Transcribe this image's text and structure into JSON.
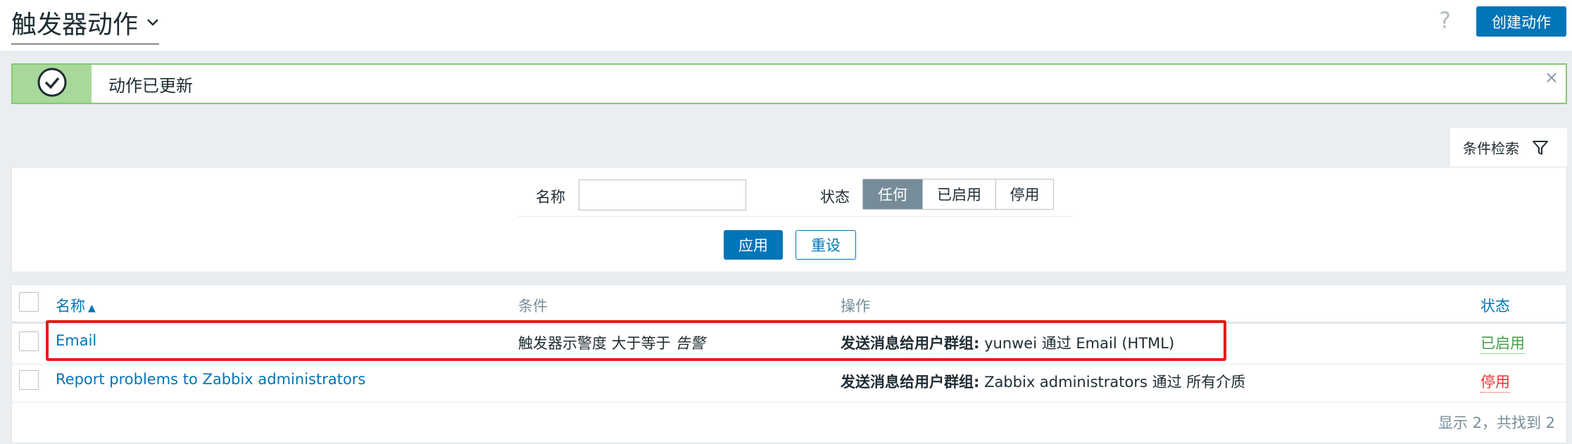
{
  "header": {
    "title": "触发器动作",
    "title_icon": "chevron-down-icon",
    "help": "?",
    "create_label": "创建动作"
  },
  "message": {
    "text": "动作已更新",
    "icon": "check-circle-icon",
    "close": "×"
  },
  "filter": {
    "tab_label": "条件检索",
    "tab_icon": "funnel-icon",
    "name_label": "名称",
    "name_value": "",
    "status_label": "状态",
    "status_options": [
      "任何",
      "已启用",
      "停用"
    ],
    "status_selected": "任何",
    "apply_label": "应用",
    "reset_label": "重设"
  },
  "table": {
    "columns": {
      "name": "名称",
      "conditions": "条件",
      "operations": "操作",
      "status": "状态"
    },
    "sort_indicator": "▲",
    "rows": [
      {
        "name": "Email",
        "conditions_main": "触发器示警度 大于等于 ",
        "conditions_italic": "告警",
        "operation_bold": "发送消息给用户群组:",
        "operation_rest": " yunwei 通过 Email (HTML)",
        "status": "已启用"
      },
      {
        "name": "Report problems to Zabbix administrators",
        "conditions_main": "",
        "conditions_italic": "",
        "operation_bold": "发送消息给用户群组:",
        "operation_rest": " Zabbix administrators 通过 所有介质",
        "status": "停用"
      }
    ],
    "footer": "显示 2，共找到 2"
  },
  "colors": {
    "accent": "#0275b8",
    "enabled": "#429e47",
    "disabled": "#e33734",
    "success_border": "#86c972",
    "highlight": "#e81b14"
  }
}
